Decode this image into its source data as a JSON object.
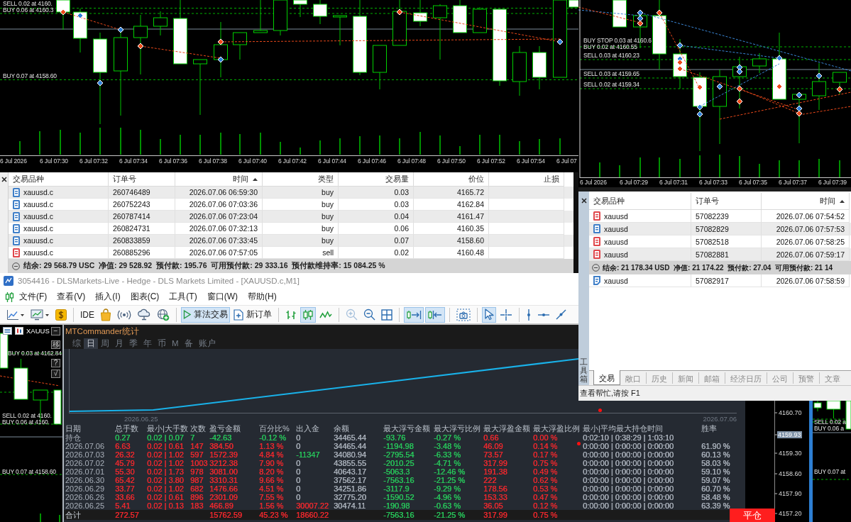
{
  "top_chart": {
    "order_lines": [
      "SELL 0.02 at 4160.",
      "BUY 0.06 at 4160.3",
      "BUY 0.07 at 4158.60"
    ],
    "time_axis": [
      "6 Jul 2026",
      "6 Jul 07:30",
      "6 Jul 07:32",
      "6 Jul 07:34",
      "6 Jul 07:36",
      "6 Jul 07:38",
      "6 Jul 07:40",
      "6 Jul 07:42",
      "6 Jul 07:44",
      "6 Jul 07:46",
      "6 Jul 07:48",
      "6 Jul 07:50",
      "6 Jul 07:52",
      "6 Jul 07:54",
      "6 Jul 07"
    ]
  },
  "trade_table": {
    "columns": [
      {
        "label": "交易品种",
        "sorted": false
      },
      {
        "label": "订单号",
        "sorted": false
      },
      {
        "label": "时间",
        "sorted": true
      },
      {
        "label": "类型",
        "sorted": false
      },
      {
        "label": "交易量",
        "sorted": false
      },
      {
        "label": "价位",
        "sorted": false
      },
      {
        "label": "止损",
        "sorted": false
      }
    ],
    "rows": [
      {
        "symbol": "xauusd.c",
        "order": "260746489",
        "time": "2026.07.06 06:59:30",
        "type": "buy",
        "volume": "0.03",
        "price": "4165.72",
        "color": "#3f7fc8"
      },
      {
        "symbol": "xauusd.c",
        "order": "260752243",
        "time": "2026.07.06 07:03:36",
        "type": "buy",
        "volume": "0.03",
        "price": "4162.84",
        "color": "#3f7fc8"
      },
      {
        "symbol": "xauusd.c",
        "order": "260787414",
        "time": "2026.07.06 07:23:04",
        "type": "buy",
        "volume": "0.04",
        "price": "4161.47",
        "color": "#3f7fc8"
      },
      {
        "symbol": "xauusd.c",
        "order": "260824731",
        "time": "2026.07.06 07:32:13",
        "type": "buy",
        "volume": "0.06",
        "price": "4160.35",
        "color": "#3f7fc8"
      },
      {
        "symbol": "xauusd.c",
        "order": "260833859",
        "time": "2026.07.06 07:33:45",
        "type": "buy",
        "volume": "0.07",
        "price": "4158.60",
        "color": "#3f7fc8"
      },
      {
        "symbol": "xauusd.c",
        "order": "260885296",
        "time": "2026.07.06 07:57:05",
        "type": "sell",
        "volume": "0.02",
        "price": "4160.48",
        "color": "#e0474c"
      }
    ],
    "summary": "结余: 29 568.79 USC  净值: 29 528.92  预付款: 195.76  可用预付款: 29 333.16  预付款维持率: 15 084.25 %"
  },
  "main_window": {
    "title": "3054416 - DLSMarkets-Live - Hedge - DLS Markets Limited - [XAUUSD.c,M1]",
    "menu": [
      "文件(F)",
      "查看(V)",
      "插入(I)",
      "图表(C)",
      "工具(T)",
      "窗口(W)",
      "帮助(H)"
    ],
    "toolbar": [
      {
        "kind": "icon",
        "on": false,
        "disabled": false
      },
      {
        "kind": "icon",
        "on": false,
        "disabled": false
      },
      {
        "kind": "icon",
        "on": false,
        "disabled": false
      },
      {
        "kind": "separator"
      },
      {
        "kind": "button",
        "label": "IDE",
        "on": false,
        "disabled": false
      },
      {
        "kind": "icon",
        "on": false,
        "disabled": false
      },
      {
        "kind": "icon",
        "on": false,
        "disabled": false
      },
      {
        "kind": "icon",
        "on": false,
        "disabled": false
      },
      {
        "kind": "icon",
        "on": false,
        "disabled": false
      },
      {
        "kind": "separator"
      },
      {
        "kind": "button",
        "label": "算法交易",
        "on": true,
        "disabled": false
      },
      {
        "kind": "button",
        "label": "新订单",
        "on": false,
        "disabled": false
      },
      {
        "kind": "separator"
      },
      {
        "kind": "icon",
        "on": false,
        "disabled": false
      },
      {
        "kind": "icon",
        "on": true,
        "disabled": false
      },
      {
        "kind": "icon",
        "on": false,
        "disabled": false
      },
      {
        "kind": "separator"
      },
      {
        "kind": "icon",
        "on": false,
        "disabled": true
      },
      {
        "kind": "icon",
        "on": false,
        "disabled": false
      },
      {
        "kind": "icon",
        "on": false,
        "disabled": false
      },
      {
        "kind": "separator"
      },
      {
        "kind": "icon",
        "on": true,
        "disabled": false
      },
      {
        "kind": "icon",
        "on": true,
        "disabled": false
      },
      {
        "kind": "separator"
      },
      {
        "kind": "icon",
        "on": false,
        "disabled": false
      },
      {
        "kind": "separator"
      },
      {
        "kind": "icon",
        "on": true,
        "disabled": false
      },
      {
        "kind": "icon",
        "on": false,
        "disabled": false
      },
      {
        "kind": "separator"
      },
      {
        "kind": "icon",
        "on": false,
        "disabled": false
      },
      {
        "kind": "icon",
        "on": false,
        "disabled": false
      },
      {
        "kind": "icon",
        "on": false,
        "disabled": false
      }
    ],
    "chart": {
      "title": "XAUUS",
      "tool_buttons": [
        "−",
        "移",
        "?",
        "√"
      ],
      "order_lines": [
        "BUY 0.03 at 4162.84",
        "SELL 0.02 at 4160.",
        "BUY 0.06 at 4160.",
        "BUY 0.07 at 4158.60"
      ]
    },
    "side_chart": {
      "price_axis": [
        {
          "label": "4160.70",
          "current": false
        },
        {
          "label": "4159.93",
          "current": true
        },
        {
          "label": "4159.30",
          "current": false
        },
        {
          "label": "4158.60",
          "current": false
        },
        {
          "label": "4157.90",
          "current": false
        },
        {
          "label": "4157.20",
          "current": false
        }
      ],
      "order_lines": [
        "SELL 0.02 a",
        "BUY 0.06 a",
        "BUY 0.07 at"
      ],
      "close_button": "平仓"
    }
  },
  "stats_panel": {
    "title": "MTCommander统计",
    "tabs": [
      {
        "label": "综",
        "selected": false
      },
      {
        "label": "日",
        "selected": true
      },
      {
        "label": "周",
        "selected": false
      },
      {
        "label": "月",
        "selected": false
      },
      {
        "label": "季",
        "selected": false
      },
      {
        "label": "年",
        "selected": false
      },
      {
        "label": "币",
        "selected": false
      },
      {
        "label": "M",
        "selected": false
      },
      {
        "label": "备",
        "selected": false
      },
      {
        "label": "账户",
        "selected": false
      }
    ],
    "chart_dates": [
      "2026.06.25",
      "2026.07.06"
    ],
    "columns": [
      "日期",
      "总手数",
      "最小|大手数",
      "次数",
      "盈亏金额",
      "百分比%",
      "出入金",
      "余额",
      "最大浮亏金额",
      "最大浮亏比例",
      "最大浮盈金额",
      "最大浮盈比例",
      "最小|平均最大持仓时间",
      "胜率"
    ],
    "rows": [
      {
        "label": "持仓",
        "lots": {
          "text": "0.27",
          "color": "#27c65a"
        },
        "lot_range": {
          "text": "0.02 | 0.07",
          "color": "#27c65a"
        },
        "trades": {
          "text": "7",
          "color": "#27c65a"
        },
        "pnl": {
          "text": "-42.63",
          "color": "#27c65a"
        },
        "pnl_pct": {
          "text": "-0.12 %",
          "color": "#27c65a"
        },
        "deposits": {
          "text": "0",
          "color": "#a9b0ba"
        },
        "balance": {
          "text": "34465.44",
          "color": "#a9b0ba"
        },
        "max_loss": {
          "text": "-93.76",
          "color": "#27c65a"
        },
        "max_loss_pct": {
          "text": "-0.27 %",
          "color": "#27c65a"
        },
        "max_profit": {
          "text": "0.66",
          "color": "#f0282d"
        },
        "max_profit_pct": {
          "text": "0.00 %",
          "color": "#f0282d"
        },
        "hold_times": {
          "text": "0:02:10 | 0:38:29 | 1:03:10",
          "color": "#a9b0ba"
        }
      },
      {
        "label": "2026.07.06",
        "lots": {
          "text": "6.63",
          "color": "#f0282d"
        },
        "lot_range": {
          "text": "0.02 | 0.61",
          "color": "#f0282d"
        },
        "trades": {
          "text": "147",
          "color": "#f0282d"
        },
        "pnl": {
          "text": "384.50",
          "color": "#f0282d"
        },
        "pnl_pct": {
          "text": "1.13 %",
          "color": "#f0282d"
        },
        "deposits": {
          "text": "0",
          "color": "#a9b0ba"
        },
        "balance": {
          "text": "34465.44",
          "color": "#a9b0ba"
        },
        "max_loss": {
          "text": "-1194.98",
          "color": "#27c65a"
        },
        "max_loss_pct": {
          "text": "-3.48 %",
          "color": "#27c65a"
        },
        "max_profit": {
          "text": "46.09",
          "color": "#f0282d"
        },
        "max_profit_pct": {
          "text": "0.14 %",
          "color": "#f0282d"
        },
        "hold_times": {
          "text": "0:00:00 | 0:00:00 | 0:00:00",
          "color": "#a9b0ba"
        },
        "win_rate": {
          "text": "61.90 %",
          "color": "#a9b0ba"
        }
      },
      {
        "label": "2026.07.03",
        "lots": {
          "text": "26.32",
          "color": "#f0282d"
        },
        "lot_range": {
          "text": "0.02 | 1.02",
          "color": "#f0282d"
        },
        "trades": {
          "text": "597",
          "color": "#f0282d"
        },
        "pnl": {
          "text": "1572.39",
          "color": "#f0282d"
        },
        "pnl_pct": {
          "text": "4.84 %",
          "color": "#f0282d"
        },
        "deposits": {
          "text": "-11347",
          "color": "#27c65a"
        },
        "balance": {
          "text": "34080.94",
          "color": "#a9b0ba"
        },
        "max_loss": {
          "text": "-2795.54",
          "color": "#27c65a"
        },
        "max_loss_pct": {
          "text": "-6.33 %",
          "color": "#27c65a"
        },
        "max_profit": {
          "text": "73.57",
          "color": "#f0282d"
        },
        "max_profit_pct": {
          "text": "0.17 %",
          "color": "#f0282d"
        },
        "hold_times": {
          "text": "0:00:00 | 0:00:00 | 0:00:00",
          "color": "#a9b0ba"
        },
        "win_rate": {
          "text": "60.13 %",
          "color": "#a9b0ba"
        }
      },
      {
        "label": "2026.07.02",
        "lots": {
          "text": "45.79",
          "color": "#f0282d"
        },
        "lot_range": {
          "text": "0.02 | 1.02",
          "color": "#f0282d"
        },
        "trades": {
          "text": "1003",
          "color": "#f0282d"
        },
        "pnl": {
          "text": "3212.38",
          "color": "#f0282d"
        },
        "pnl_pct": {
          "text": "7.90 %",
          "color": "#f0282d"
        },
        "deposits": {
          "text": "0",
          "color": "#a9b0ba"
        },
        "balance": {
          "text": "43855.55",
          "color": "#a9b0ba"
        },
        "max_loss": {
          "text": "-2010.25",
          "color": "#27c65a"
        },
        "max_loss_pct": {
          "text": "-4.71 %",
          "color": "#27c65a"
        },
        "max_profit": {
          "text": "317.99",
          "color": "#f0282d"
        },
        "max_profit_pct": {
          "text": "0.75 %",
          "color": "#f0282d"
        },
        "hold_times": {
          "text": "0:00:00 | 0:00:00 | 0:00:00",
          "color": "#a9b0ba"
        },
        "win_rate": {
          "text": "58.03 %",
          "color": "#a9b0ba"
        }
      },
      {
        "label": "2026.07.01",
        "lots": {
          "text": "55.30",
          "color": "#f0282d"
        },
        "lot_range": {
          "text": "0.02 | 1.73",
          "color": "#f0282d"
        },
        "trades": {
          "text": "978",
          "color": "#f0282d"
        },
        "pnl": {
          "text": "3081.00",
          "color": "#f0282d"
        },
        "pnl_pct": {
          "text": "8.20 %",
          "color": "#f0282d"
        },
        "deposits": {
          "text": "0",
          "color": "#a9b0ba"
        },
        "balance": {
          "text": "40643.17",
          "color": "#a9b0ba"
        },
        "max_loss": {
          "text": "-5063.3",
          "color": "#27c65a"
        },
        "max_loss_pct": {
          "text": "-12.46 %",
          "color": "#27c65a"
        },
        "max_profit": {
          "text": "191.38",
          "color": "#f0282d"
        },
        "max_profit_pct": {
          "text": "0.49 %",
          "color": "#f0282d"
        },
        "hold_times": {
          "text": "0:00:00 | 0:00:00 | 0:00:00",
          "color": "#a9b0ba"
        },
        "win_rate": {
          "text": "59.10 %",
          "color": "#a9b0ba"
        }
      },
      {
        "label": "2026.06.30",
        "lots": {
          "text": "65.42",
          "color": "#f0282d"
        },
        "lot_range": {
          "text": "0.02 | 3.80",
          "color": "#f0282d"
        },
        "trades": {
          "text": "987",
          "color": "#f0282d"
        },
        "pnl": {
          "text": "3310.31",
          "color": "#f0282d"
        },
        "pnl_pct": {
          "text": "9.66 %",
          "color": "#f0282d"
        },
        "deposits": {
          "text": "0",
          "color": "#a9b0ba"
        },
        "balance": {
          "text": "37562.17",
          "color": "#a9b0ba"
        },
        "max_loss": {
          "text": "-7563.16",
          "color": "#27c65a"
        },
        "max_loss_pct": {
          "text": "-21.25 %",
          "color": "#27c65a"
        },
        "max_profit": {
          "text": "222",
          "color": "#f0282d"
        },
        "max_profit_pct": {
          "text": "0.62 %",
          "color": "#f0282d"
        },
        "hold_times": {
          "text": "0:00:00 | 0:00:00 | 0:00:00",
          "color": "#a9b0ba"
        },
        "win_rate": {
          "text": "59.07 %",
          "color": "#a9b0ba"
        }
      },
      {
        "label": "2026.06.29",
        "lots": {
          "text": "33.77",
          "color": "#f0282d"
        },
        "lot_range": {
          "text": "0.02 | 1.02",
          "color": "#f0282d"
        },
        "trades": {
          "text": "682",
          "color": "#f0282d"
        },
        "pnl": {
          "text": "1476.66",
          "color": "#f0282d"
        },
        "pnl_pct": {
          "text": "4.51 %",
          "color": "#f0282d"
        },
        "deposits": {
          "text": "0",
          "color": "#a9b0ba"
        },
        "balance": {
          "text": "34251.86",
          "color": "#a9b0ba"
        },
        "max_loss": {
          "text": "-3117.9",
          "color": "#27c65a"
        },
        "max_loss_pct": {
          "text": "-9.29 %",
          "color": "#27c65a"
        },
        "max_profit": {
          "text": "178.56",
          "color": "#f0282d"
        },
        "max_profit_pct": {
          "text": "0.53 %",
          "color": "#f0282d"
        },
        "hold_times": {
          "text": "0:00:00 | 0:00:00 | 0:00:00",
          "color": "#a9b0ba"
        },
        "win_rate": {
          "text": "60.70 %",
          "color": "#a9b0ba"
        }
      },
      {
        "label": "2026.06.26",
        "lots": {
          "text": "33.66",
          "color": "#f0282d"
        },
        "lot_range": {
          "text": "0.02 | 0.61",
          "color": "#f0282d"
        },
        "trades": {
          "text": "896",
          "color": "#f0282d"
        },
        "pnl": {
          "text": "2301.09",
          "color": "#f0282d"
        },
        "pnl_pct": {
          "text": "7.55 %",
          "color": "#f0282d"
        },
        "deposits": {
          "text": "0",
          "color": "#a9b0ba"
        },
        "balance": {
          "text": "32775.20",
          "color": "#a9b0ba"
        },
        "max_loss": {
          "text": "-1590.52",
          "color": "#27c65a"
        },
        "max_loss_pct": {
          "text": "-4.96 %",
          "color": "#27c65a"
        },
        "max_profit": {
          "text": "153.33",
          "color": "#f0282d"
        },
        "max_profit_pct": {
          "text": "0.47 %",
          "color": "#f0282d"
        },
        "hold_times": {
          "text": "0:00:00 | 0:00:00 | 0:00:00",
          "color": "#a9b0ba"
        },
        "win_rate": {
          "text": "58.48 %",
          "color": "#a9b0ba"
        }
      },
      {
        "label": "2026.06.25",
        "lots": {
          "text": "5.41",
          "color": "#f0282d"
        },
        "lot_range": {
          "text": "0.02 | 0.13",
          "color": "#f0282d"
        },
        "trades": {
          "text": "183",
          "color": "#f0282d"
        },
        "pnl": {
          "text": "466.89",
          "color": "#f0282d"
        },
        "pnl_pct": {
          "text": "1.56 %",
          "color": "#f0282d"
        },
        "deposits": {
          "text": "30007.22",
          "color": "#f0282d"
        },
        "balance": {
          "text": "30474.11",
          "color": "#a9b0ba"
        },
        "max_loss": {
          "text": "-190.98",
          "color": "#27c65a"
        },
        "max_loss_pct": {
          "text": "-0.63 %",
          "color": "#27c65a"
        },
        "max_profit": {
          "text": "36.05",
          "color": "#f0282d"
        },
        "max_profit_pct": {
          "text": "0.12 %",
          "color": "#f0282d"
        },
        "hold_times": {
          "text": "0:00:00 | 0:00:00 | 0:00:00",
          "color": "#a9b0ba"
        },
        "win_rate": {
          "text": "63.39 %",
          "color": "#a9b0ba"
        }
      }
    ],
    "total": {
      "label": "合计",
      "lots": {
        "text": "272.57",
        "color": "#f0282d"
      },
      "pnl": {
        "text": "15762.59",
        "color": "#f0282d"
      },
      "pnl_pct": {
        "text": "45.23 %",
        "color": "#f0282d"
      },
      "deposits": {
        "text": "18660.22",
        "color": "#f0282d"
      },
      "max_loss": {
        "text": "-7563.16",
        "color": "#27c65a"
      },
      "max_loss_pct": {
        "text": "-21.25 %",
        "color": "#27c65a"
      },
      "max_profit": {
        "text": "317.99",
        "color": "#f0282d"
      },
      "max_profit_pct": {
        "text": "0.75 %",
        "color": "#f0282d"
      }
    }
  },
  "second_terminal": {
    "chart": {
      "order_lines": [
        "BUY STOP 0.03 at 4160.6",
        "BUY 0.02 at 4160.55",
        "SELL 0.03 at 4160.23",
        "SELL 0.03 at 4159.65",
        "SELL 0.02 at 4159.34"
      ],
      "time_axis": [
        "6 Jul 2026",
        "6 Jul 07:29",
        "6 Jul 07:31",
        "6 Jul 07:33",
        "6 Jul 07:35",
        "6 Jul 07:37",
        "6 Jul 07:39"
      ]
    },
    "toolbox": {
      "label": "工具箱",
      "columns": [
        {
          "label": "交易品种",
          "sorted": false
        },
        {
          "label": "订单号",
          "sorted": false
        },
        {
          "label": "时间",
          "sorted": true
        }
      ],
      "positions": [
        {
          "symbol": "xauusd",
          "order": "57082239",
          "time": "2026.07.06 07:54:52",
          "color": "#e0474c"
        },
        {
          "symbol": "xauusd",
          "order": "57082829",
          "time": "2026.07.06 07:57:53",
          "color": "#3f7fc8"
        },
        {
          "symbol": "xauusd",
          "order": "57082518",
          "time": "2026.07.06 07:58:25",
          "color": "#e0474c"
        },
        {
          "symbol": "xauusd",
          "order": "57082881",
          "time": "2026.07.06 07:59:17",
          "color": "#e0474c"
        }
      ],
      "summary": "结余: 21 178.34 USD  净值: 21 174.22  预付款: 27.04  可用预付款: 21 14",
      "orders": [
        {
          "symbol": "xauusd",
          "order": "57082917",
          "time": "2026.07.06 07:58:59",
          "color": "#3f7fc8"
        }
      ],
      "tabs": [
        {
          "label": "交易",
          "selected": true
        },
        {
          "label": "敞口",
          "selected": false
        },
        {
          "label": "历史",
          "selected": false
        },
        {
          "label": "新闻",
          "selected": false
        },
        {
          "label": "邮箱",
          "selected": false
        },
        {
          "label": "经济日历",
          "selected": false
        },
        {
          "label": "公司",
          "selected": false
        },
        {
          "label": "预警",
          "selected": false
        },
        {
          "label": "文章",
          "selected": false
        }
      ],
      "status": "查看帮忙,请按 F1"
    }
  }
}
